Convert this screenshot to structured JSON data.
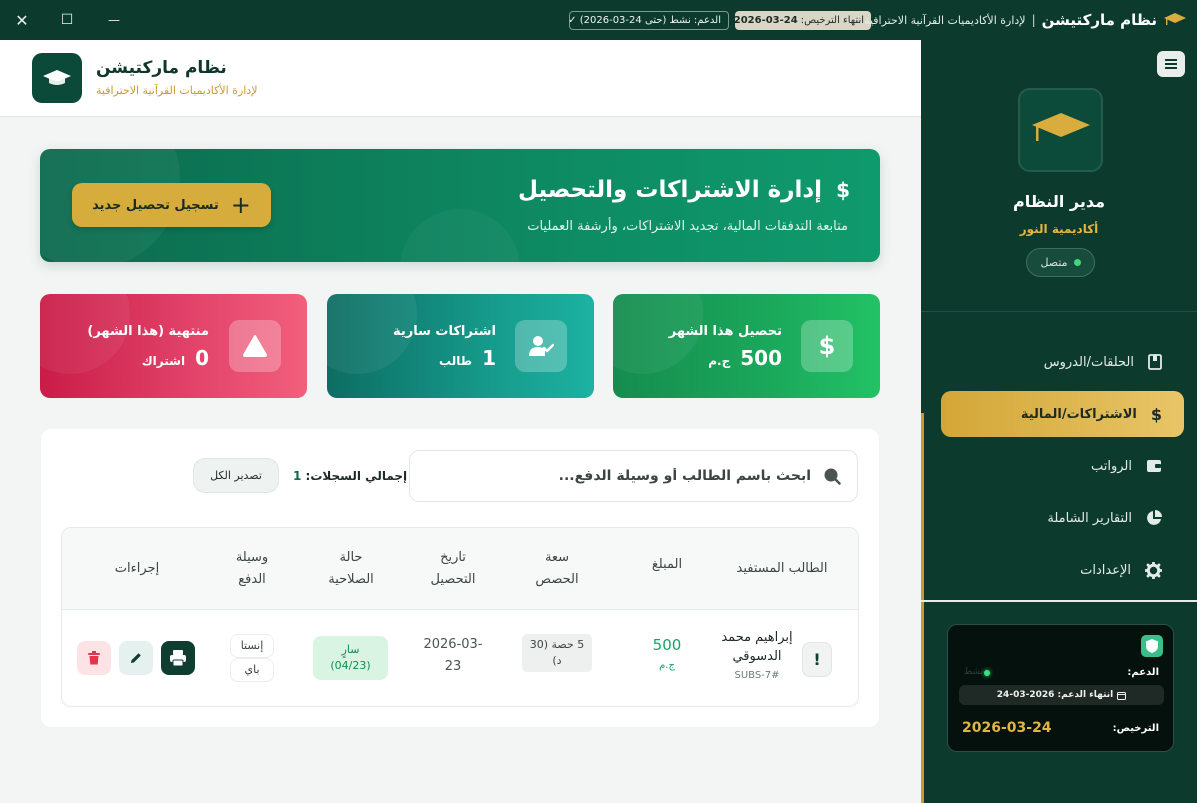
{
  "titlebar": {
    "app_name": "نظام ماركتيشن",
    "app_subtitle": "لإدارة الأكاديميات القرآنية الاحترافية",
    "separator": "|",
    "license_label": "انتهاء الترخيص:",
    "license_date": "2026-03-24",
    "support_status": "الدعم: نشط (حتى 24-03-2026) ✓",
    "close_glyph": "✕",
    "maximize_glyph": "☐",
    "minimize_glyph": "—"
  },
  "header": {
    "title": "نظام ماركتيشن",
    "subtitle": "لإدارة الأكاديميات القرآنية الاحترافية"
  },
  "hero": {
    "title": "إدارة الاشتراكات والتحصيل",
    "subtitle": "متابعة التدفقات المالية، تجديد الاشتراكات، وأرشفة العمليات",
    "button_label": "تسجيل تحصيل جديد",
    "dollar_glyph": "$",
    "plus_glyph": "+"
  },
  "stats": {
    "expired": {
      "label": "منتهية (هذا الشهر)",
      "value": "0",
      "unit": "اشتراك"
    },
    "active": {
      "label": "اشتراكات سارية",
      "value": "1",
      "unit": "طالب"
    },
    "collected": {
      "label": "تحصيل هذا الشهر",
      "value": "500",
      "unit": "ج.م"
    }
  },
  "records": {
    "search_placeholder": "ابحث باسم الطالب أو وسيلة الدفع...",
    "total_label": "إجمالي السجلات:",
    "total_count": "1",
    "export_label": "تصدير الكل",
    "columns": {
      "student": "الطالب المستفيد",
      "amount": "المبلغ",
      "capacity_1": "سعة",
      "capacity_2": "الحصص",
      "date_1": "تاريخ",
      "date_2": "التحصيل",
      "status_1": "حالة",
      "status_2": "الصلاحية",
      "method_1": "وسيلة",
      "method_2": "الدفع",
      "actions": "إجراءات"
    },
    "rows": [
      {
        "marker": "!",
        "student_name": "إبراهيم محمد الدسوقي",
        "student_id": "SUBS-7#",
        "amount": "500",
        "currency": "ج.م",
        "capacity": "5 حصة (30 د)",
        "date": "2026-03-23",
        "status_1": "سارٍ",
        "status_2": "(04/23)",
        "method_1": "إنستا",
        "method_2": "باي"
      }
    ]
  },
  "sidebar": {
    "user_name": "مدير النظام",
    "academy": "أكاديمية النور",
    "status": "متصل",
    "nav": [
      {
        "label": "الحلقات/الدروس",
        "icon": "book-icon"
      },
      {
        "label": "الاشتراكات/المالية",
        "icon": "dollar-icon",
        "active": true
      },
      {
        "label": "الرواتب",
        "icon": "wallet-icon"
      },
      {
        "label": "التقارير الشاملة",
        "icon": "pie-chart-icon"
      },
      {
        "label": "الإعدادات",
        "icon": "gear-icon"
      }
    ],
    "card": {
      "support_label": "الدعم:",
      "support_faint": "نشط",
      "support_end": "انتهاء الدعم: 2026-03-24",
      "license_label": "الترخيص:",
      "license_value": "2026-03-24"
    }
  },
  "colors": {
    "primary_dark": "#0c3b2e",
    "accent_gold": "#d6ad3c",
    "success": "#17a364",
    "danger": "#c91c47"
  }
}
